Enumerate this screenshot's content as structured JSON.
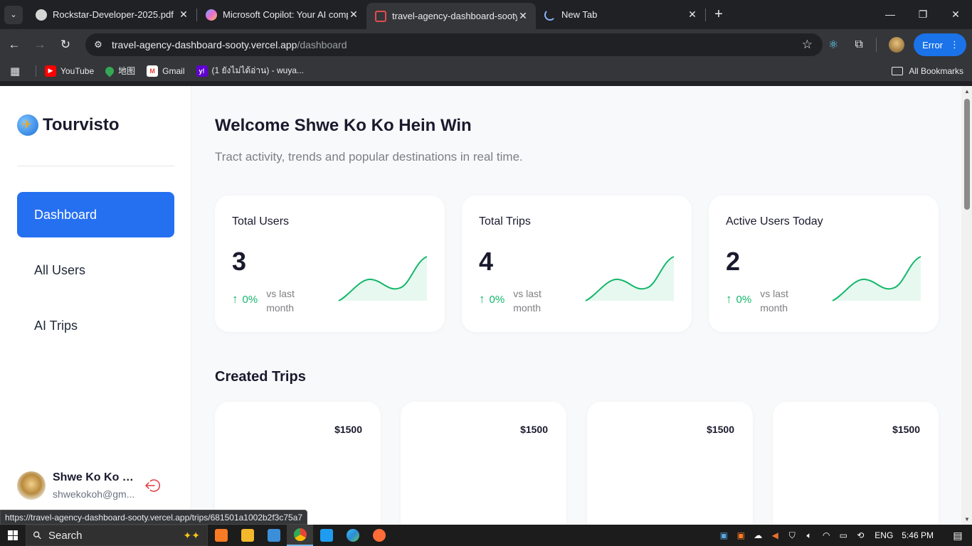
{
  "browser": {
    "tabs": [
      {
        "title": "Rockstar-Developer-2025.pdf",
        "favicon_color": "#d6d6d6"
      },
      {
        "title": "Microsoft Copilot: Your AI comp",
        "favicon_color": "#6fa8ff"
      },
      {
        "title": "travel-agency-dashboard-sooty",
        "favicon_color": "#e34c4c"
      },
      {
        "title": "New Tab",
        "favicon_color": "#8ab4f8"
      }
    ],
    "url_host": "travel-agency-dashboard-sooty.vercel.app",
    "url_path": "/dashboard",
    "error_chip": "Error",
    "bookmarks": [
      {
        "label": "YouTube",
        "color": "#ff0000"
      },
      {
        "label": "地图",
        "color": "#34a853"
      },
      {
        "label": "Gmail",
        "color": "#ea4335"
      },
      {
        "label": "(1 ยังไม่ได้อ่าน) - wuya...",
        "color": "#6001d2"
      }
    ],
    "all_bookmarks": "All Bookmarks",
    "status_url": "https://travel-agency-dashboard-sooty.vercel.app/trips/681501a1002b2f3c75a7"
  },
  "sidebar": {
    "brand": "Tourvisto",
    "nav": [
      {
        "label": "Dashboard",
        "active": true
      },
      {
        "label": "All Users",
        "active": false
      },
      {
        "label": "AI Trips",
        "active": false
      }
    ],
    "user": {
      "name": "Shwe Ko Ko H...",
      "email": "shwekokoh@gm..."
    }
  },
  "main": {
    "title": "Welcome Shwe Ko Ko Hein Win",
    "subtitle": "Tract activity, trends and popular destinations in real time.",
    "stats": [
      {
        "label": "Total Users",
        "value": "3",
        "change": "0%",
        "comparison": "vs last month"
      },
      {
        "label": "Total Trips",
        "value": "4",
        "change": "0%",
        "comparison": "vs last month"
      },
      {
        "label": "Active Users Today",
        "value": "2",
        "change": "0%",
        "comparison": "vs last month"
      }
    ],
    "created_trips_title": "Created Trips",
    "trips": [
      {
        "price": "$1500"
      },
      {
        "price": "$1500"
      },
      {
        "price": "$1500"
      },
      {
        "price": "$1500"
      }
    ]
  },
  "taskbar": {
    "search_placeholder": "Search",
    "language": "ENG",
    "time": "5:46 PM"
  },
  "colors": {
    "accent": "#256ff1",
    "trend_up": "#12b76a"
  }
}
